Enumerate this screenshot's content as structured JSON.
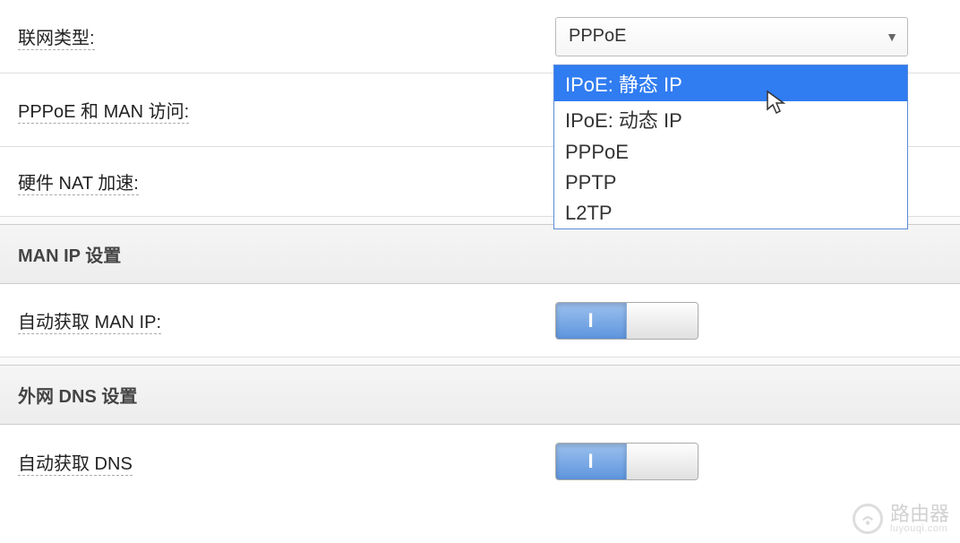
{
  "rows": {
    "connection_type": {
      "label": "联网类型:"
    },
    "pppoe_man": {
      "label": "PPPoE 和 MAN 访问:"
    },
    "hw_nat": {
      "label": "硬件 NAT 加速:"
    },
    "auto_man_ip": {
      "label": "自动获取 MAN IP:"
    },
    "auto_dns": {
      "label": "自动获取 DNS"
    }
  },
  "select": {
    "current": "PPPoE",
    "options": [
      "IPoE: 静态 IP",
      "IPoE: 动态 IP",
      "PPPoE",
      "PPTP",
      "L2TP"
    ],
    "highlight_index": 0
  },
  "sections": {
    "man_ip": "MAN IP 设置",
    "wan_dns": "外网 DNS 设置"
  },
  "toggle": {
    "on_glyph": "I"
  },
  "watermark": {
    "title": "路由器",
    "sub": "luyouqi.com"
  }
}
